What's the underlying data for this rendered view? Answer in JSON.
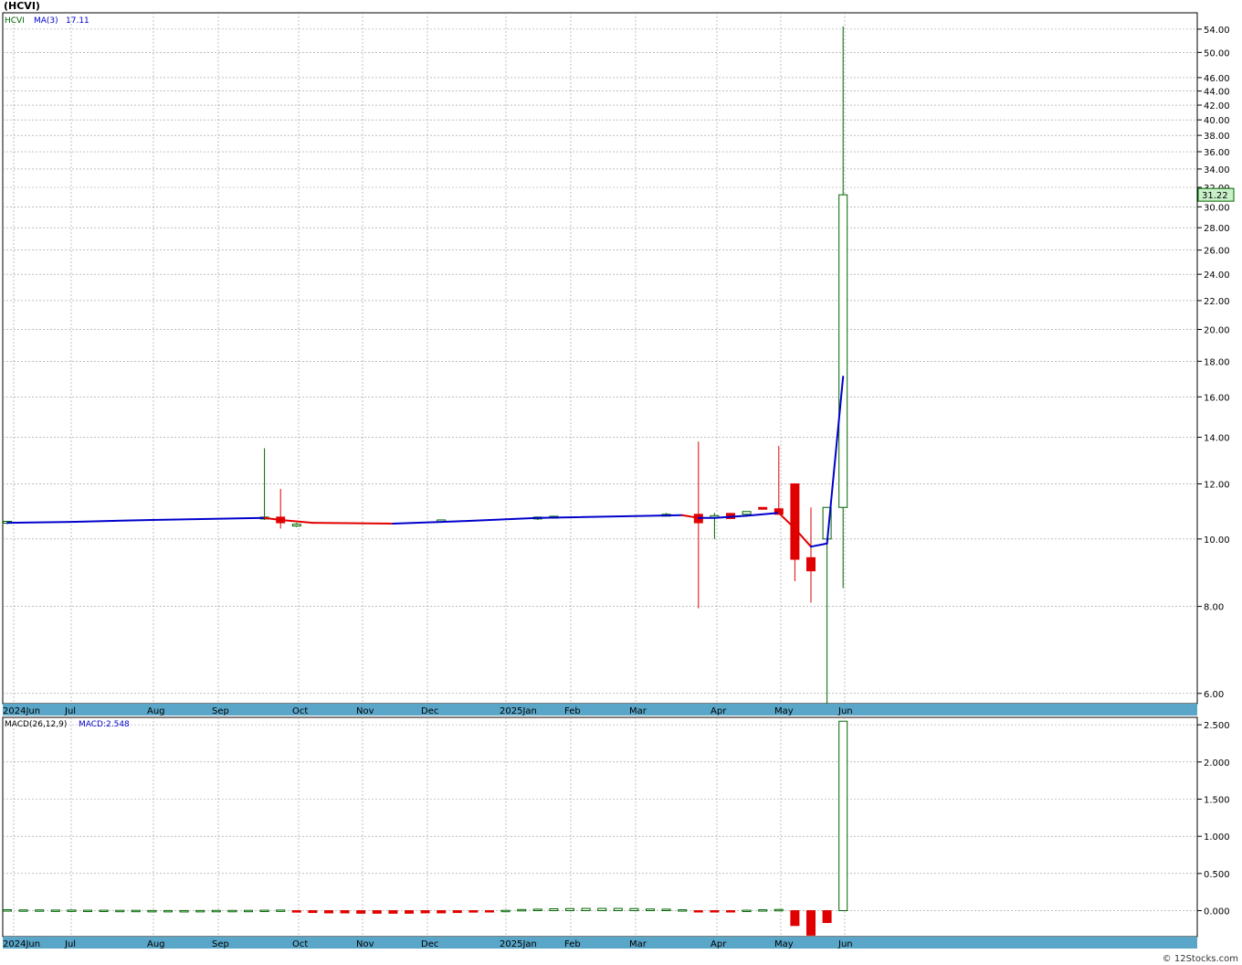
{
  "title": "(HCVI)",
  "credit": "© 12Stocks.com",
  "colors": {
    "up": "#006400",
    "down": "#e00000",
    "ma": "#0000cc",
    "ma_down": "#e00000",
    "grid": "#999999",
    "axis_band": "#5aa6c8",
    "last_price_bg": "#c8f0c8"
  },
  "price_legend": {
    "symbol": "HCVI",
    "ma_label": "MA(3)",
    "ma_value": "17.11"
  },
  "macd_legend": {
    "label": "MACD(26,12,9)",
    "value_label": "MACD:2.548"
  },
  "last_price": "31.22",
  "chart_data": [
    {
      "type": "candlestick",
      "scale": "log",
      "ylim": [
        5.8,
        57
      ],
      "y_ticks": [
        "54.00",
        "50.00",
        "46.00",
        "44.00",
        "42.00",
        "40.00",
        "38.00",
        "36.00",
        "34.00",
        "32.00",
        "30.00",
        "28.00",
        "26.00",
        "24.00",
        "22.00",
        "20.00",
        "18.00",
        "16.00",
        "14.00",
        "12.00",
        "10.00",
        "8.00",
        "6.00"
      ],
      "x_labels": [
        "2024Jun",
        "Jul",
        "Aug",
        "Sep",
        "Oct",
        "Nov",
        "Dec",
        "2025Jan",
        "Feb",
        "Mar",
        "Apr",
        "May",
        "Jun"
      ],
      "candles": [
        {
          "w": 0,
          "o": 10.55,
          "h": 10.6,
          "l": 10.5,
          "c": 10.6
        },
        {
          "w": 16,
          "o": 10.7,
          "h": 13.5,
          "l": 10.65,
          "c": 10.75
        },
        {
          "w": 17,
          "o": 10.75,
          "h": 11.8,
          "l": 10.35,
          "c": 10.55
        },
        {
          "w": 18,
          "o": 10.45,
          "h": 10.55,
          "l": 10.4,
          "c": 10.5
        },
        {
          "w": 27,
          "o": 10.6,
          "h": 10.65,
          "l": 10.55,
          "c": 10.65
        },
        {
          "w": 33,
          "o": 10.7,
          "h": 10.75,
          "l": 10.65,
          "c": 10.75
        },
        {
          "w": 34,
          "o": 10.75,
          "h": 10.8,
          "l": 10.7,
          "c": 10.78
        },
        {
          "w": 41,
          "o": 10.85,
          "h": 10.9,
          "l": 10.8,
          "c": 10.85
        },
        {
          "w": 43,
          "o": 10.85,
          "h": 13.8,
          "l": 7.95,
          "c": 10.55
        },
        {
          "w": 44,
          "o": 10.75,
          "h": 10.9,
          "l": 10.0,
          "c": 10.8
        },
        {
          "w": 45,
          "o": 10.88,
          "h": 10.9,
          "l": 10.7,
          "c": 10.7
        },
        {
          "w": 46,
          "o": 10.85,
          "h": 10.95,
          "l": 10.8,
          "c": 10.95
        },
        {
          "w": 47,
          "o": 11.1,
          "h": 11.1,
          "l": 11.05,
          "c": 11.05
        },
        {
          "w": 48,
          "o": 11.05,
          "h": 13.6,
          "l": 10.9,
          "c": 10.85
        },
        {
          "w": 49,
          "o": 12.0,
          "h": 12.0,
          "l": 8.7,
          "c": 9.35
        },
        {
          "w": 50,
          "o": 9.4,
          "h": 11.1,
          "l": 8.1,
          "c": 9.0
        },
        {
          "w": 51,
          "o": 10.0,
          "h": 11.1,
          "l": 5.8,
          "c": 11.1
        },
        {
          "w": 52,
          "o": 11.1,
          "h": 54.5,
          "l": 8.5,
          "c": 31.22
        }
      ],
      "ma": [
        {
          "w": 0,
          "v": 10.55
        },
        {
          "w": 4,
          "v": 10.58
        },
        {
          "w": 9,
          "v": 10.65
        },
        {
          "w": 16,
          "v": 10.72
        },
        {
          "w": 17,
          "v": 10.65
        },
        {
          "w": 19,
          "v": 10.55
        },
        {
          "w": 24,
          "v": 10.52
        },
        {
          "w": 28,
          "v": 10.6
        },
        {
          "w": 33,
          "v": 10.72
        },
        {
          "w": 42,
          "v": 10.82
        },
        {
          "w": 43,
          "v": 10.72
        },
        {
          "w": 44,
          "v": 10.72
        },
        {
          "w": 46,
          "v": 10.8
        },
        {
          "w": 48,
          "v": 10.9
        },
        {
          "w": 49,
          "v": 10.35
        },
        {
          "w": 50,
          "v": 9.75
        },
        {
          "w": 51,
          "v": 9.85
        },
        {
          "w": 52,
          "v": 17.11
        }
      ]
    },
    {
      "type": "bar",
      "ylim": [
        -0.35,
        2.6
      ],
      "y_ticks": [
        "2.500",
        "2.000",
        "1.500",
        "1.000",
        "0.500",
        "0.000"
      ],
      "x_labels": [
        "2024Jun",
        "Jul",
        "Aug",
        "Sep",
        "Oct",
        "Nov",
        "Dec",
        "2025Jan",
        "Feb",
        "Mar",
        "Apr",
        "May",
        "Jun"
      ],
      "bars": [
        0.012,
        0.01,
        0.01,
        0.008,
        0.008,
        0.006,
        0.006,
        0.004,
        0.004,
        0.002,
        0.002,
        0.001,
        0.002,
        0.003,
        0.003,
        0.004,
        0.006,
        0.008,
        -0.02,
        -0.025,
        -0.03,
        -0.03,
        -0.035,
        -0.035,
        -0.035,
        -0.035,
        -0.03,
        -0.03,
        -0.025,
        -0.02,
        -0.01,
        0.004,
        0.015,
        0.02,
        0.025,
        0.028,
        0.03,
        0.03,
        0.03,
        0.028,
        0.022,
        0.02,
        0.012,
        -0.008,
        -0.006,
        -0.004,
        0.006,
        0.012,
        0.016,
        -0.2,
        -0.33,
        -0.16,
        2.548
      ]
    }
  ]
}
